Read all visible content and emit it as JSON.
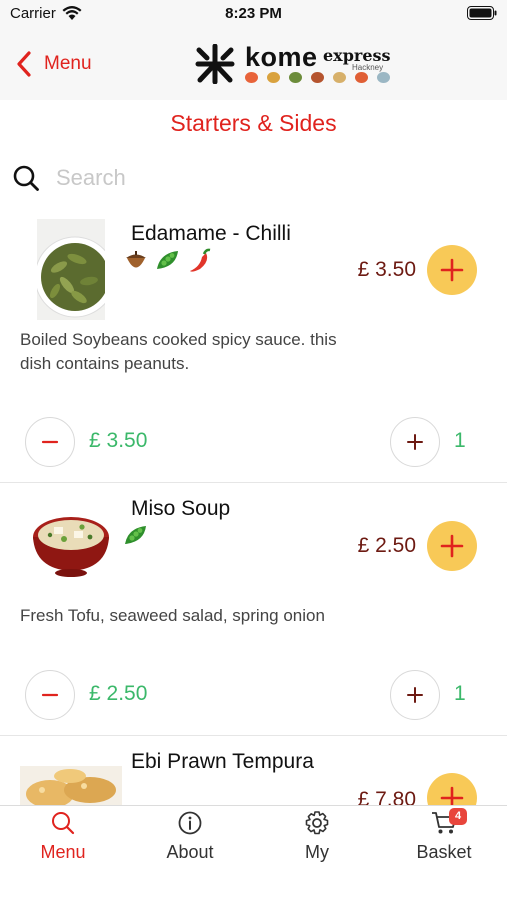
{
  "status_bar": {
    "carrier": "Carrier",
    "time": "8:23 PM"
  },
  "header": {
    "back_label": "Menu",
    "logo_word": "kome",
    "logo_express": "express",
    "logo_sub": "Hackney"
  },
  "section_title": "Starters & Sides",
  "search": {
    "placeholder": "Search",
    "value": ""
  },
  "items": [
    {
      "name": "Edamame - Chilli",
      "icons": [
        "nut-icon",
        "vegetarian-pea-icon",
        "chilli-icon"
      ],
      "price": "£ 3.50",
      "description": "Boiled Soybeans cooked spicy sauce. this dish contains peanuts.",
      "line_price": "£ 3.50",
      "quantity": "1"
    },
    {
      "name": "Miso Soup",
      "icons": [
        "vegetarian-pea-icon"
      ],
      "price": "£ 2.50",
      "description": "Fresh Tofu, seaweed salad, spring onion",
      "line_price": "£ 2.50",
      "quantity": "1"
    },
    {
      "name": "Ebi Prawn Tempura",
      "icons": [],
      "price": "£ 7.80"
    }
  ],
  "tab_bar": {
    "tabs": [
      {
        "label": "Menu",
        "icon": "search-icon",
        "active": true
      },
      {
        "label": "About",
        "icon": "info-icon",
        "active": false
      },
      {
        "label": "My",
        "icon": "gear-icon",
        "active": false
      },
      {
        "label": "Basket",
        "icon": "cart-icon",
        "active": false
      }
    ],
    "basket_badge": "4"
  },
  "colors": {
    "accent_red": "#e0231e",
    "price_brown": "#6d1a12",
    "add_button_yellow": "#f8c957",
    "green": "#3bb86a"
  }
}
